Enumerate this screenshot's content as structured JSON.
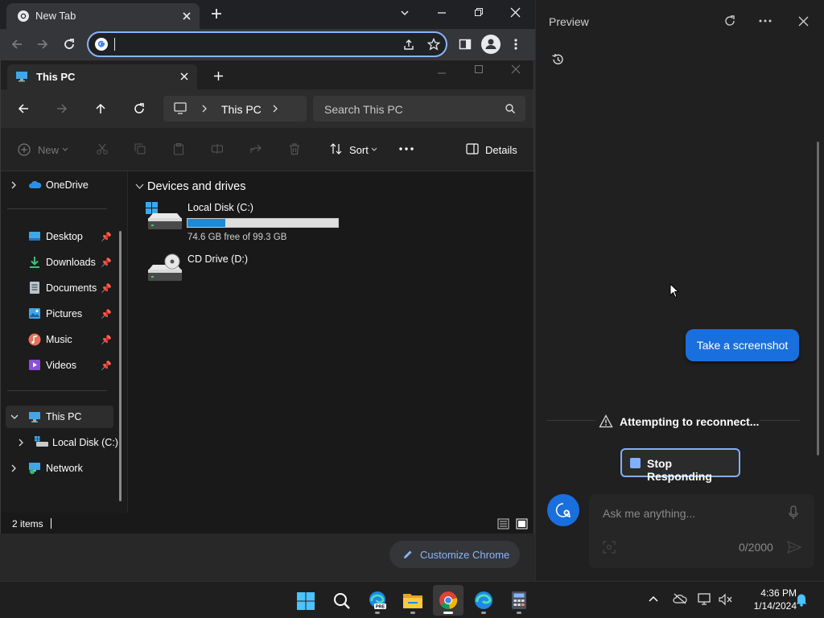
{
  "chrome": {
    "tab_title": "New Tab",
    "omnibox_value": "",
    "customize_label": "Customize Chrome"
  },
  "explorer": {
    "tab_title": "This PC",
    "breadcrumb": "This PC",
    "search_placeholder": "Search This PC",
    "commands": {
      "new_label": "New",
      "sort_label": "Sort",
      "details_label": "Details"
    },
    "sidebar": {
      "onedrive": "OneDrive",
      "quick": [
        {
          "label": "Desktop",
          "icon": "desktop-icon"
        },
        {
          "label": "Downloads",
          "icon": "downloads-icon"
        },
        {
          "label": "Documents",
          "icon": "documents-icon"
        },
        {
          "label": "Pictures",
          "icon": "pictures-icon"
        },
        {
          "label": "Music",
          "icon": "music-icon"
        },
        {
          "label": "Videos",
          "icon": "videos-icon"
        }
      ],
      "this_pc": "This PC",
      "local_disk": "Local Disk (C:)",
      "network": "Network"
    },
    "group_header": "Devices and drives",
    "drives": [
      {
        "name": "Local Disk (C:)",
        "free_text": "74.6 GB free of 99.3 GB",
        "used_fraction": 0.249
      },
      {
        "name": "CD Drive (D:)"
      }
    ],
    "status": "2 items"
  },
  "copilot": {
    "title": "Preview",
    "screenshot_button": "Take a screenshot",
    "reconnect_text": "Attempting to reconnect...",
    "stop_button": "Stop Responding",
    "ask_placeholder": "Ask me anything...",
    "char_count": "0/2000"
  },
  "taskbar": {
    "time": "4:36 PM",
    "date": "1/14/2024"
  },
  "colors": {
    "accent": "#1a6fdf",
    "chrome_link": "#8ab4f8",
    "drive_fill": "#1f8ad2"
  }
}
